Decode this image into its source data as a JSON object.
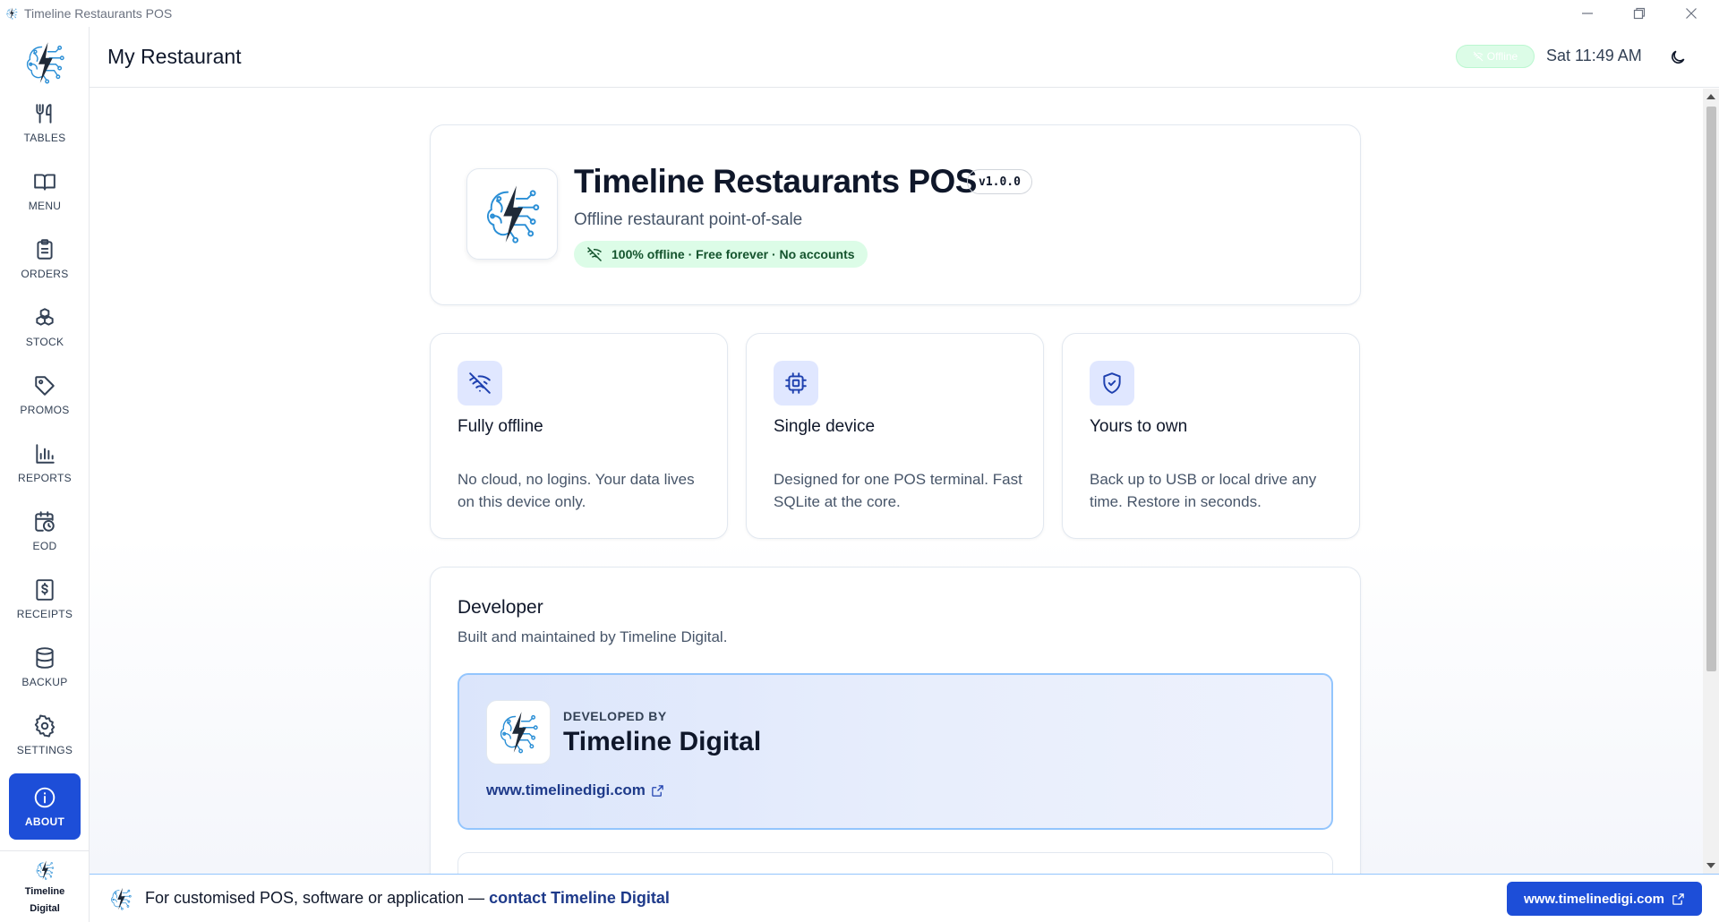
{
  "window": {
    "title": "Timeline Restaurants POS"
  },
  "sidebar": {
    "items": [
      {
        "label": "TABLES",
        "icon": "utensils-icon"
      },
      {
        "label": "MENU",
        "icon": "book-icon"
      },
      {
        "label": "ORDERS",
        "icon": "clipboard-icon"
      },
      {
        "label": "STOCK",
        "icon": "boxes-icon"
      },
      {
        "label": "PROMOS",
        "icon": "tag-icon"
      },
      {
        "label": "REPORTS",
        "icon": "bar-chart-icon"
      },
      {
        "label": "EOD",
        "icon": "calendar-clock-icon"
      },
      {
        "label": "RECEIPTS",
        "icon": "receipt-icon"
      },
      {
        "label": "BACKUP",
        "icon": "database-icon"
      },
      {
        "label": "SETTINGS",
        "icon": "gear-icon"
      },
      {
        "label": "ABOUT",
        "icon": "info-icon"
      }
    ],
    "active": "ABOUT",
    "brand_line1": "Timeline",
    "brand_line2": "Digital"
  },
  "header": {
    "title": "My Restaurant",
    "status_badge": "Offline",
    "clock": "Sat 11:49 AM"
  },
  "hero": {
    "title": "Timeline Restaurants POS",
    "version": "v1.0.0",
    "subtitle": "Offline restaurant point-of-sale",
    "pill": "100% offline · Free forever · No accounts"
  },
  "features": [
    {
      "title": "Fully offline",
      "desc": "No cloud, no logins. Your data lives on this device only.",
      "icon": "wifi-off-icon"
    },
    {
      "title": "Single device",
      "desc": "Designed for one POS terminal. Fast SQLite at the core.",
      "icon": "cpu-icon"
    },
    {
      "title": "Yours to own",
      "desc": "Back up to USB or local drive any time. Restore in seconds.",
      "icon": "shield-check-icon"
    }
  ],
  "developer": {
    "heading": "Developer",
    "subheading": "Built and maintained by Timeline Digital.",
    "by_label": "DEVELOPED BY",
    "name": "Timeline Digital",
    "link": "www.timelinedigi.com"
  },
  "footer": {
    "text": "For customised POS, software or application —",
    "link_text": "contact Timeline Digital",
    "button": "www.timelinedigi.com"
  },
  "colors": {
    "accent": "#1d4ed8",
    "success_bg": "#dcfce7",
    "success_text": "#14532d",
    "icon_bg": "#e0e7ff"
  }
}
